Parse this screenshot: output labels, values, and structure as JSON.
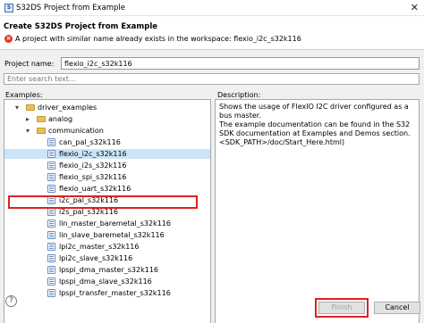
{
  "window": {
    "title": "S32DS Project from Example",
    "close_glyph": "✕"
  },
  "header": {
    "title": "Create S32DS Project from Example",
    "error_message": "A project with similar name already exists in the workspace: flexio_i2c_s32k116"
  },
  "project_name": {
    "label": "Project name:",
    "value": "flexio_i2c_s32k116"
  },
  "search": {
    "placeholder": "Enter search text..."
  },
  "examples": {
    "label": "Examples:",
    "tree": [
      {
        "label": "driver_examples",
        "type": "folder",
        "expanded": true
      },
      {
        "label": "analog",
        "type": "folder",
        "expanded": false
      },
      {
        "label": "communication",
        "type": "folder",
        "expanded": true
      },
      {
        "label": "can_pal_s32k116",
        "type": "project"
      },
      {
        "label": "flexio_i2c_s32k116",
        "type": "project",
        "selected": true
      },
      {
        "label": "flexio_i2s_s32k116",
        "type": "project"
      },
      {
        "label": "flexio_spi_s32k116",
        "type": "project"
      },
      {
        "label": "flexio_uart_s32k116",
        "type": "project"
      },
      {
        "label": "i2c_pal_s32k116",
        "type": "project"
      },
      {
        "label": "i2s_pal_s32k116",
        "type": "project"
      },
      {
        "label": "lin_master_baremetal_s32k116",
        "type": "project"
      },
      {
        "label": "lin_slave_baremetal_s32k116",
        "type": "project"
      },
      {
        "label": "lpi2c_master_s32k116",
        "type": "project"
      },
      {
        "label": "lpi2c_slave_s32k116",
        "type": "project"
      },
      {
        "label": "lpspi_dma_master_s32k116",
        "type": "project"
      },
      {
        "label": "lpspi_dma_slave_s32k116",
        "type": "project"
      },
      {
        "label": "lpspi_transfer_master_s32k116",
        "type": "project"
      }
    ]
  },
  "description": {
    "label": "Description:",
    "lines": [
      "Shows the usage of FlexIO I2C driver configured as a bus master.",
      "The example documentation can be found in the S32 SDK documentation at Examples and Demos section.",
      "<SDK_PATH>/doc/Start_Here.html)"
    ]
  },
  "buttons": {
    "help": "?",
    "finish": "Finish",
    "cancel": "Cancel"
  },
  "icons": {
    "error": "error-icon",
    "folder": "folder-icon",
    "project": "project-icon",
    "help": "help-icon"
  },
  "colors": {
    "highlight": "#e02020",
    "selection": "#cce4f7",
    "error": "#d9382b"
  }
}
